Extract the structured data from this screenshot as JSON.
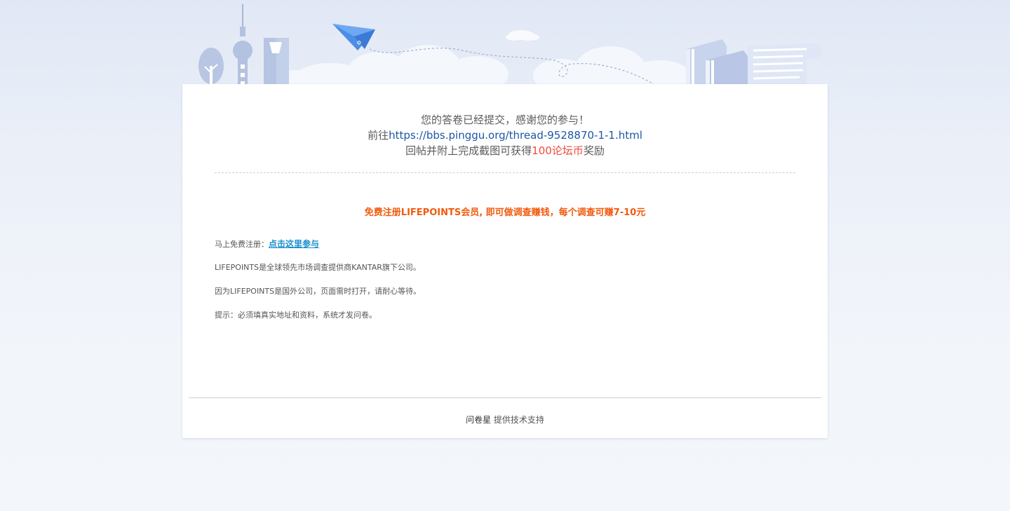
{
  "confirmation": {
    "line1": "您的答卷已经提交，感谢您的参与！",
    "line2_prefix": "前往",
    "link_url": "https://bbs.pinggu.org/thread-9528870-1-1.html",
    "line3_prefix": "回帖并附上完成截图可获得",
    "reward": "100论坛币",
    "line3_suffix": "奖励"
  },
  "promo": {
    "headline": "免费注册LIFEPOINTS会员, 即可做调查赚钱，每个调查可赚7-10元",
    "register_label": "马上免费注册：",
    "register_link": "点击这里参与",
    "info1": "LIFEPOINTS是全球领先市场调查提供商KANTAR旗下公司。",
    "info2": "因为LIFEPOINTS是国外公司，页面需时打开，请耐心等待。",
    "info3": "提示：必须填真实地址和资料，系统才发问卷。"
  },
  "footer": {
    "brand": "问卷星",
    "text": "提供技术支持"
  },
  "colors": {
    "link": "#1d57a6",
    "reward": "#f04a3c",
    "promo": "#f15a0d",
    "register_link": "#1a8fce"
  },
  "icons": [
    "tree-icon",
    "tv-tower-icon",
    "skyscraper-icon",
    "paper-plane-icon",
    "cloud-icon",
    "books-icon",
    "paper-scroll-icon"
  ]
}
